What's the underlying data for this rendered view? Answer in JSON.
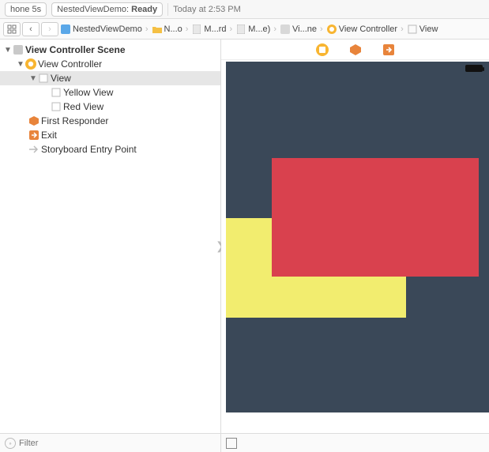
{
  "status": {
    "device": "hone 5s",
    "project": "NestedViewDemo:",
    "state": "Ready",
    "time": "Today at 2:53 PM"
  },
  "breadcrumb": {
    "items": [
      {
        "label": "NestedViewDemo",
        "icon": "project-icon"
      },
      {
        "label": "N...o",
        "icon": "folder-icon"
      },
      {
        "label": "M...rd",
        "icon": "file-icon"
      },
      {
        "label": "M...e)",
        "icon": "file-icon"
      },
      {
        "label": "Vi...ne",
        "icon": "scene-icon"
      },
      {
        "label": "View Controller",
        "icon": "vc-icon"
      },
      {
        "label": "View",
        "icon": "view-icon"
      }
    ]
  },
  "outline": {
    "scene": "View Controller Scene",
    "vc": "View Controller",
    "view": "View",
    "yellow": "Yellow View",
    "red": "Red View",
    "responder": "First Responder",
    "exit": "Exit",
    "entry": "Storyboard Entry Point"
  },
  "filter": {
    "placeholder": "Filter"
  },
  "canvas": {
    "bg": "#3a4858",
    "yellow": "#f2ed6f",
    "red": "#d9414e"
  }
}
